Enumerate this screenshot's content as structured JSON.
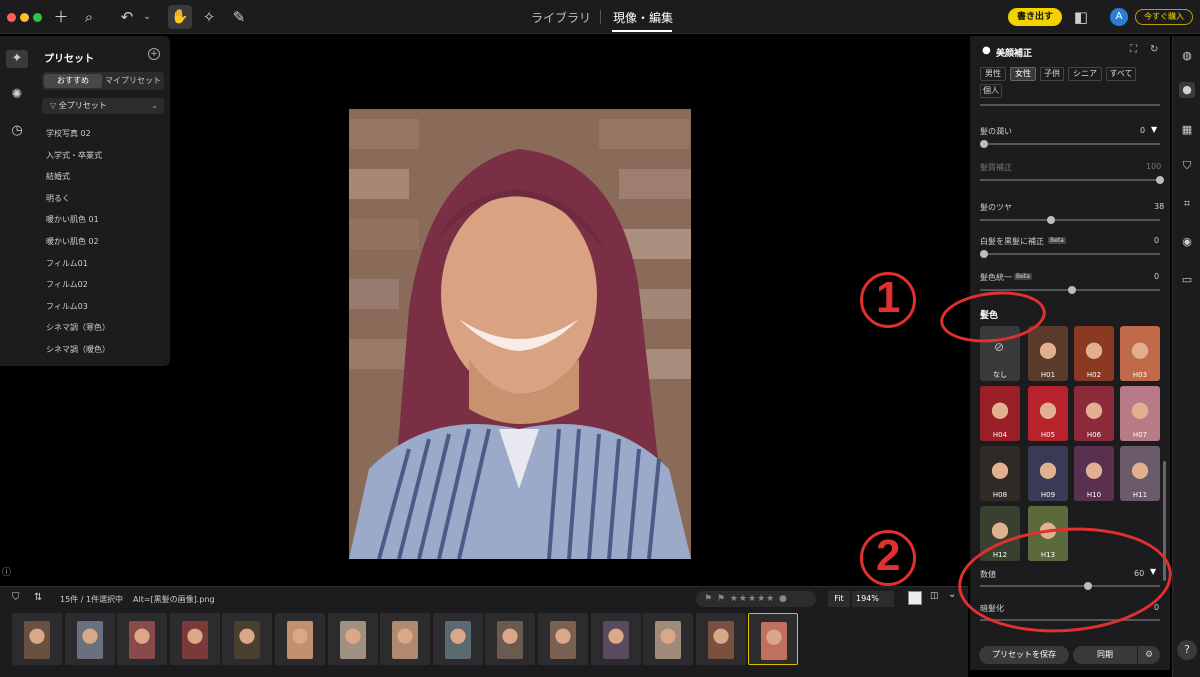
{
  "topbar": {
    "tabs": [
      "ライブラリ",
      "現像・編集"
    ],
    "export_label": "書き出す",
    "avatar_initial": "A",
    "buy_label": "今すぐ購入"
  },
  "presets": {
    "title": "プリセット",
    "segment": [
      "おすすめ",
      "マイプリセット"
    ],
    "filter_label": "全プリセット",
    "items": [
      "学校写真 02",
      "入学式・卒業式",
      "結婚式",
      "明るく",
      "暖かい肌色 01",
      "暖かい肌色 02",
      "フィルム01",
      "フィルム02",
      "フィルム03",
      "シネマ調（寒色）",
      "シネマ調（暖色）"
    ]
  },
  "beauty": {
    "title": "美顔補正",
    "chips": [
      "男性",
      "女性",
      "子供",
      "シニア",
      "すべて",
      "個人"
    ],
    "active_chip": "女性",
    "sliders": [
      {
        "label": "髪の潤い",
        "value": "0"
      },
      {
        "label": "髪質補正",
        "value": "100"
      },
      {
        "label": "髪のツヤ",
        "value": "38"
      },
      {
        "label": "白髪を黒髪に補正",
        "value": "0",
        "badge": "Beta"
      },
      {
        "label": "髪色統一",
        "value": "0",
        "badge": "Beta"
      }
    ],
    "hair_color_title": "髪色",
    "none_label": "なし",
    "swatches": [
      {
        "label": "H01",
        "color": "#5a3a2a"
      },
      {
        "label": "H02",
        "color": "#8a3a22"
      },
      {
        "label": "H03",
        "color": "#c06a4a"
      },
      {
        "label": "H04",
        "color": "#9b1f28"
      },
      {
        "label": "H05",
        "color": "#b8232b"
      },
      {
        "label": "H06",
        "color": "#8c2a3a"
      },
      {
        "label": "H07",
        "color": "#b87a86"
      },
      {
        "label": "H08",
        "color": "#2f2a26"
      },
      {
        "label": "H09",
        "color": "#3a3a56"
      },
      {
        "label": "H10",
        "color": "#5a3050"
      },
      {
        "label": "H11",
        "color": "#6a5a6a"
      },
      {
        "label": "H12",
        "color": "#3a4030"
      },
      {
        "label": "H13",
        "color": "#5a6a3a"
      }
    ],
    "amount_label": "数値",
    "amount_value": "60",
    "dark_label": "暗髪化",
    "dark_value": "0",
    "save_preset_label": "プリセットを保存",
    "sync_label": "同期"
  },
  "filmstrip": {
    "count_label": "15件 / 1件選択中",
    "alt_label": "Alt=[黒髪の画像].png",
    "fit_label": "Fit",
    "zoom_label": "194%",
    "thumbnails": [
      "#6a5040",
      "#6a7080",
      "#8a4a4a",
      "#7a3a3a",
      "#4a4030",
      "#c09070",
      "#a09080",
      "#b08a70",
      "#5a6a70",
      "#6a5a50",
      "#7a6050",
      "#5a4a60",
      "#a08a7a",
      "#7a5040",
      "#c07060"
    ]
  },
  "annotations": [
    "1",
    "2"
  ]
}
